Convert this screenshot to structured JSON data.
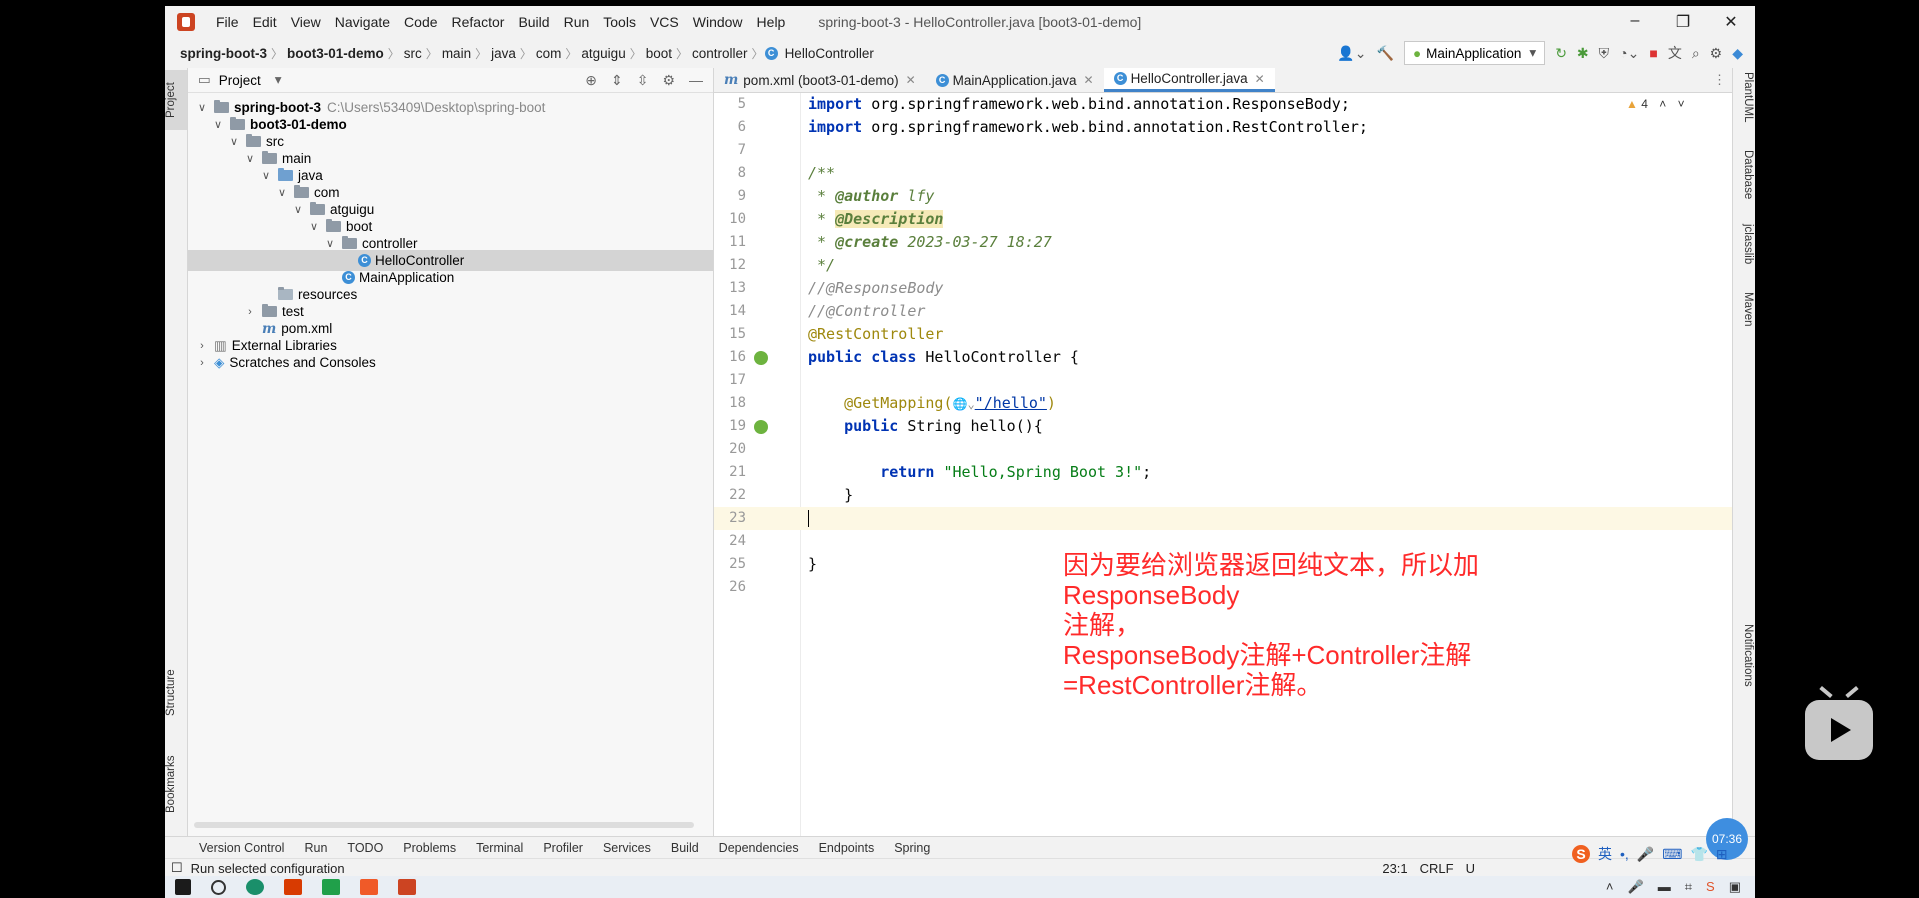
{
  "window": {
    "menu": [
      "File",
      "Edit",
      "View",
      "Navigate",
      "Code",
      "Refactor",
      "Build",
      "Run",
      "Tools",
      "VCS",
      "Window",
      "Help"
    ],
    "title": "spring-boot-3 - HelloController.java [boot3-01-demo]",
    "controls": {
      "minimize": "–",
      "maximize": "❐",
      "close": "✕"
    }
  },
  "breadcrumb": [
    "spring-boot-3",
    "boot3-01-demo",
    "src",
    "main",
    "java",
    "com",
    "atguigu",
    "boot",
    "controller",
    "HelloController"
  ],
  "run_config": "MainApplication",
  "left_tabs": {
    "project": "Project",
    "structure": "Structure",
    "bookmarks": "Bookmarks"
  },
  "project_panel": {
    "title": "Project",
    "tree": [
      {
        "label": "spring-boot-3",
        "hint": "C:\\Users\\53409\\Desktop\\spring-boot",
        "depth": 0,
        "bold": true,
        "chev": "∨"
      },
      {
        "label": "boot3-01-demo",
        "depth": 1,
        "bold": true,
        "chev": "∨"
      },
      {
        "label": "src",
        "depth": 2,
        "chev": "∨"
      },
      {
        "label": "main",
        "depth": 3,
        "chev": "∨"
      },
      {
        "label": "java",
        "depth": 4,
        "chev": "∨",
        "kind": "src"
      },
      {
        "label": "com",
        "depth": 5,
        "chev": "∨"
      },
      {
        "label": "atguigu",
        "depth": 6,
        "chev": "∨"
      },
      {
        "label": "boot",
        "depth": 7,
        "chev": "∨"
      },
      {
        "label": "controller",
        "depth": 8,
        "chev": "∨"
      },
      {
        "label": "HelloController",
        "depth": 9,
        "kind": "class",
        "selected": true
      },
      {
        "label": "MainApplication",
        "depth": 8,
        "kind": "class"
      },
      {
        "label": "resources",
        "depth": 4,
        "kind": "res"
      },
      {
        "label": "test",
        "depth": 3,
        "chev": "›"
      },
      {
        "label": "pom.xml",
        "depth": 3,
        "kind": "maven"
      },
      {
        "label": "External Libraries",
        "depth": 0,
        "chev": "›",
        "kind": "lib"
      },
      {
        "label": "Scratches and Consoles",
        "depth": 0,
        "chev": "›",
        "kind": "scratch"
      }
    ]
  },
  "editor_tabs": [
    {
      "label": "pom.xml (boot3-01-demo)",
      "icon": "m",
      "active": false
    },
    {
      "label": "MainApplication.java",
      "icon": "c",
      "active": false
    },
    {
      "label": "HelloController.java",
      "icon": "c",
      "active": true
    }
  ],
  "warnings": "4",
  "code_lines": [
    {
      "n": "5"
    },
    {
      "n": "6"
    },
    {
      "n": "7"
    },
    {
      "n": "8"
    },
    {
      "n": "9"
    },
    {
      "n": "10"
    },
    {
      "n": "11"
    },
    {
      "n": "12"
    },
    {
      "n": "13"
    },
    {
      "n": "14"
    },
    {
      "n": "15"
    },
    {
      "n": "16"
    },
    {
      "n": "17"
    },
    {
      "n": "18"
    },
    {
      "n": "19"
    },
    {
      "n": "20"
    },
    {
      "n": "21"
    },
    {
      "n": "22"
    },
    {
      "n": "23"
    },
    {
      "n": "24"
    },
    {
      "n": "25"
    },
    {
      "n": "26"
    }
  ],
  "code": {
    "l5_kw": "import",
    "l5_rest": " org.springframework.web.bind.annotation.ResponseBody;",
    "l6_kw": "import",
    "l6_rest": " org.springframework.web.bind.annotation.RestController;",
    "l8": "/**",
    "l9_a": " * ",
    "l9_tag": "@author",
    "l9_b": " lfy",
    "l10_a": " * ",
    "l10_tag": "@Description",
    "l11_a": " * ",
    "l11_tag": "@create",
    "l11_b": " 2023-03-27 18:27",
    "l12": " */",
    "l13": "//@ResponseBody",
    "l14": "//@Controller",
    "l15": "@RestController",
    "l16_kw": "public class",
    "l16_rest": " HelloController {",
    "l18_ann": "    @GetMapping(",
    "l18_icon": "🌐⌄",
    "l18_str": "\"/hello\"",
    "l18_end": ")",
    "l19_kw": "    public",
    "l19_rest": " String hello(){",
    "l21_kw": "        return",
    "l21_str": " \"Hello,Spring Boot 3!\"",
    "l21_end": ";",
    "l22": "    }",
    "l25": "}"
  },
  "annotation_lines": [
    "因为要给浏览器返回纯文本，所以加ResponseBody",
    "注解，",
    "ResponseBody注解+Controller注解",
    "=RestController注解。"
  ],
  "right_tabs": {
    "plantuml": "PlantUML",
    "database": "Database",
    "jclasslib": "jclasslib",
    "maven": "Maven",
    "notifications": "Notifications"
  },
  "bottom_tools": [
    "Version Control",
    "Run",
    "TODO",
    "Problems",
    "Terminal",
    "Profiler",
    "Services",
    "Build",
    "Dependencies",
    "Endpoints",
    "Spring"
  ],
  "status": {
    "message": "Run selected configuration",
    "position": "23:1",
    "line_ending": "CRLF",
    "encoding": "U"
  },
  "timer": "07:36",
  "ime": "英"
}
